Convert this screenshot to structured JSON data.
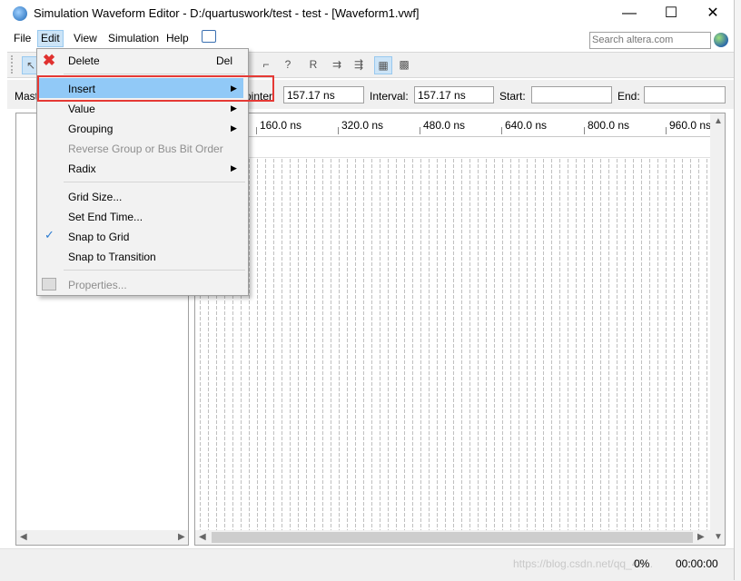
{
  "window": {
    "title": "Simulation Waveform Editor - D:/quartuswork/test - test - [Waveform1.vwf]",
    "app_icon": "quartus-app-icon",
    "controls": {
      "minimize": "—",
      "maximize": "☐",
      "close": "✕"
    }
  },
  "menubar": {
    "items": [
      {
        "label": "File",
        "active": false
      },
      {
        "label": "Edit",
        "active": true
      },
      {
        "label": "View",
        "active": false
      },
      {
        "label": "Simulation",
        "active": false
      },
      {
        "label": "Help",
        "active": false
      }
    ],
    "feedback_icon": "feedback-icon",
    "search_placeholder": "Search altera.com",
    "globe_icon": "globe-icon"
  },
  "infobar": {
    "master_label": "Mast",
    "pointer_label": "ointer",
    "pointer_value": "157.17 ns",
    "interval_label": "Interval:",
    "interval_value": "157.17 ns",
    "start_label": "Start:",
    "start_value": "",
    "end_label": "End:",
    "end_value": ""
  },
  "ruler": {
    "ticks": [
      "160.0 ns",
      "320.0 ns",
      "480.0 ns",
      "640.0 ns",
      "800.0 ns",
      "960.0 ns"
    ]
  },
  "edit_menu": {
    "delete": {
      "label": "Delete",
      "shortcut": "Del",
      "icon": "delete-x-icon"
    },
    "insert": {
      "label": "Insert",
      "highlighted": true,
      "submenu": true
    },
    "value": {
      "label": "Value",
      "submenu": true
    },
    "grouping": {
      "label": "Grouping",
      "submenu": true
    },
    "reverse": {
      "label": "Reverse Group or Bus Bit Order",
      "disabled": true
    },
    "radix": {
      "label": "Radix",
      "submenu": true
    },
    "grid_size": {
      "label": "Grid Size..."
    },
    "set_end_time": {
      "label": "Set End Time..."
    },
    "snap_to_grid": {
      "label": "Snap to Grid",
      "checked": true
    },
    "snap_to_transition": {
      "label": "Snap to Transition"
    },
    "properties": {
      "label": "Properties...",
      "disabled": true,
      "icon": "properties-icon"
    }
  },
  "statusbar": {
    "percent": "0%",
    "time": "00:00:00",
    "watermark": "https://blog.csdn.net/qq_45..."
  },
  "colors": {
    "highlight": "#91c9f7",
    "annotation_red": "#e53935",
    "menu_bg": "#f2f2f2",
    "active_menu_bg": "#cce4f7"
  }
}
